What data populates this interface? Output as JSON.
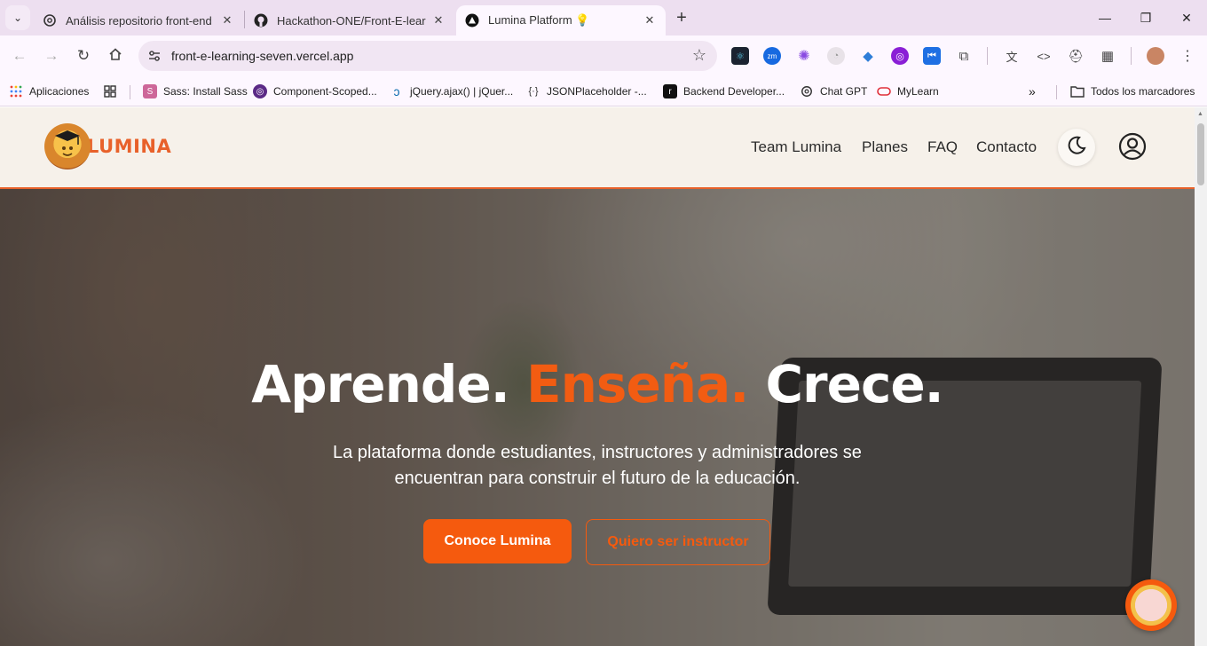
{
  "browser": {
    "tabs": [
      {
        "title": "Análisis repositorio front-end",
        "icon": "openai-icon",
        "active": false
      },
      {
        "title": "Hackathon-ONE/Front-E-learning",
        "icon": "github-icon",
        "active": false
      },
      {
        "title": "Lumina Platform 💡",
        "icon": "vercel-icon",
        "active": true
      }
    ],
    "url": "front-e-learning-seven.vercel.app",
    "bookmarks": [
      {
        "label": "Aplicaciones",
        "icon": "apps-grid-icon"
      },
      {
        "label": "",
        "icon": "grid-icon"
      },
      {
        "label": "Sass: Install Sass",
        "icon": "sass-icon"
      },
      {
        "label": "Component-Scoped...",
        "icon": "component-icon"
      },
      {
        "label": "jQuery.ajax() | jQuer...",
        "icon": "jquery-icon"
      },
      {
        "label": "JSONPlaceholder -...",
        "icon": "json-icon"
      },
      {
        "label": "Backend Developer...",
        "icon": "roadmap-icon"
      },
      {
        "label": "Chat GPT",
        "icon": "openai-icon"
      },
      {
        "label": "MyLearn",
        "icon": "mylearn-icon"
      }
    ],
    "all_bookmarks": "Todos los marcadores"
  },
  "site": {
    "brand": "LUMINA",
    "nav": [
      "Team Lumina",
      "Planes",
      "FAQ",
      "Contacto"
    ],
    "hero": {
      "title_part1": "Aprende.",
      "title_part2": "Enseña.",
      "title_part3": "Crece.",
      "subtitle": "La plataforma donde estudiantes, instructores y administradores se encuentran para construir el futuro de la educación.",
      "cta_primary": "Conoce Lumina",
      "cta_secondary": "Quiero ser instructor"
    }
  },
  "colors": {
    "accent": "#f55a0e",
    "header_bg": "#f6f1ea",
    "tabstrip_bg": "#eddff0"
  }
}
